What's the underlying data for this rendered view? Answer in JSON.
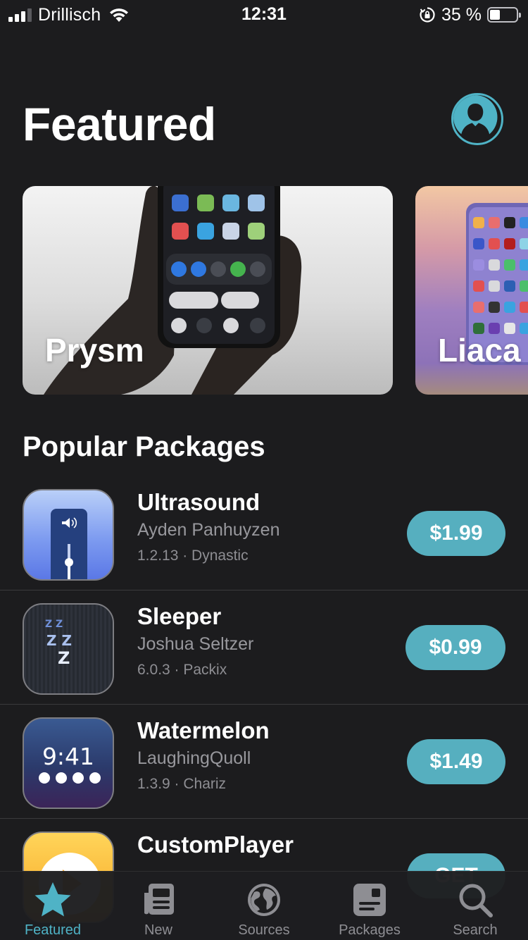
{
  "status_bar": {
    "carrier": "Drillisch",
    "time": "12:31",
    "battery_percent": "35 %",
    "battery_level": 0.35
  },
  "header": {
    "title": "Featured"
  },
  "featured": [
    {
      "label": "Prysm"
    },
    {
      "label": "Liaca"
    }
  ],
  "popular": {
    "title": "Popular Packages",
    "packages": [
      {
        "name": "Ultrasound",
        "author": "Ayden Panhuyzen",
        "meta": "1.2.13 · Dynastic",
        "price": "$1.99"
      },
      {
        "name": "Sleeper",
        "author": "Joshua Seltzer",
        "meta": "6.0.3 · Packix",
        "price": "$0.99"
      },
      {
        "name": "Watermelon",
        "author": "LaughingQuoll",
        "meta": "1.3.9 · Chariz",
        "price": "$1.49",
        "icon_time": "9:41"
      },
      {
        "name": "CustomPlayer",
        "author": "",
        "meta": "",
        "price": "GET"
      }
    ]
  },
  "tabs": [
    {
      "label": "Featured",
      "icon": "star-icon",
      "active": true
    },
    {
      "label": "New",
      "icon": "newspaper-icon",
      "active": false
    },
    {
      "label": "Sources",
      "icon": "globe-icon",
      "active": false
    },
    {
      "label": "Packages",
      "icon": "package-icon",
      "active": false
    },
    {
      "label": "Search",
      "icon": "search-icon",
      "active": false
    }
  ],
  "colors": {
    "accent": "#4fb3c6",
    "price_button": "#56afbf",
    "background": "#1c1c1e"
  }
}
